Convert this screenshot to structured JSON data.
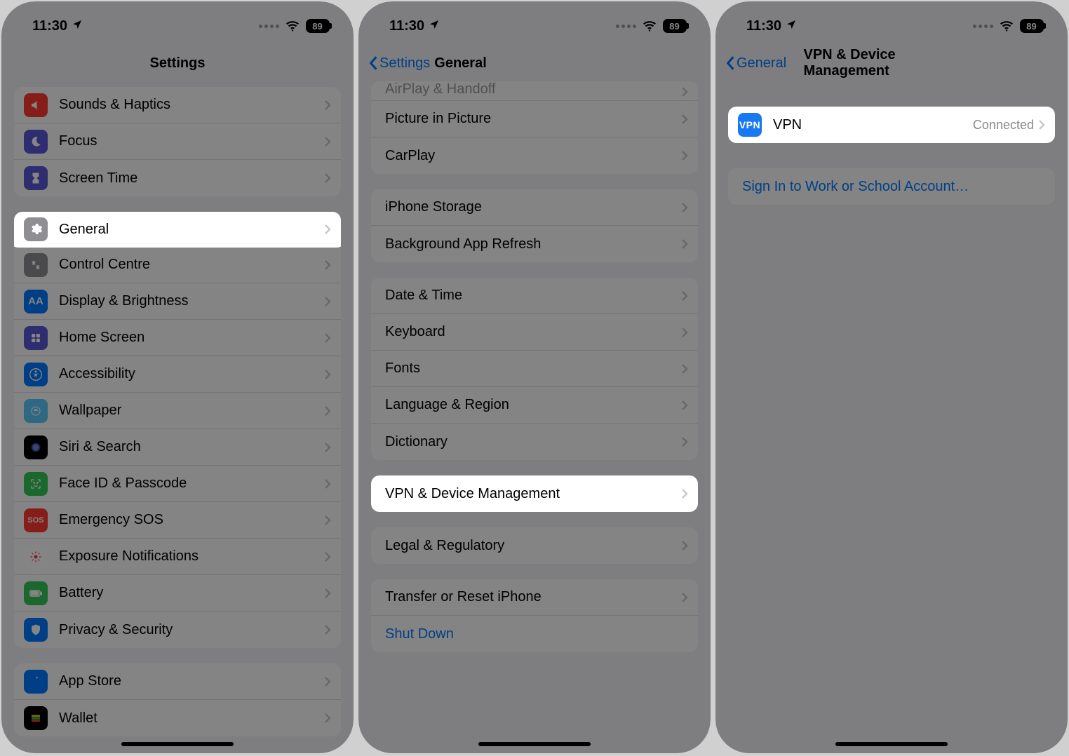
{
  "status": {
    "time": "11:30",
    "battery": "89"
  },
  "p1": {
    "title": "Settings",
    "groups": [
      {
        "rows": [
          {
            "icon": "ic-red",
            "label": "Sounds & Haptics"
          },
          {
            "icon": "ic-purple",
            "label": "Focus"
          },
          {
            "icon": "ic-purple",
            "label": "Screen Time"
          }
        ]
      },
      {
        "rows": [
          {
            "icon": "ic-gear",
            "label": "General"
          },
          {
            "icon": "ic-gray",
            "label": "Control Centre"
          },
          {
            "icon": "ic-blue",
            "label": "Display & Brightness"
          },
          {
            "icon": "ic-purple",
            "label": "Home Screen"
          },
          {
            "icon": "ic-blue",
            "label": "Accessibility"
          },
          {
            "icon": "ic-teal",
            "label": "Wallpaper"
          },
          {
            "icon": "ic-black",
            "label": "Siri & Search"
          },
          {
            "icon": "ic-green",
            "label": "Face ID & Passcode"
          },
          {
            "icon": "ic-sos",
            "label": "Emergency SOS"
          },
          {
            "icon": "ic-white",
            "label": "Exposure Notifications"
          },
          {
            "icon": "ic-green",
            "label": "Battery"
          },
          {
            "icon": "ic-blue",
            "label": "Privacy & Security"
          }
        ]
      },
      {
        "rows": [
          {
            "icon": "ic-blue",
            "label": "App Store"
          },
          {
            "icon": "ic-black",
            "label": "Wallet"
          }
        ]
      }
    ],
    "highlight_index": {
      "group": 1,
      "row": 0
    }
  },
  "p2": {
    "back": "Settings",
    "title": "General",
    "groups": [
      {
        "partial_top": true,
        "rows": [
          {
            "label": "AirPlay & Handoff"
          },
          {
            "label": "Picture in Picture"
          },
          {
            "label": "CarPlay"
          }
        ]
      },
      {
        "rows": [
          {
            "label": "iPhone Storage"
          },
          {
            "label": "Background App Refresh"
          }
        ]
      },
      {
        "rows": [
          {
            "label": "Date & Time"
          },
          {
            "label": "Keyboard"
          },
          {
            "label": "Fonts"
          },
          {
            "label": "Language & Region"
          },
          {
            "label": "Dictionary"
          }
        ]
      },
      {
        "rows": [
          {
            "label": "VPN & Device Management"
          }
        ]
      },
      {
        "rows": [
          {
            "label": "Legal & Regulatory"
          }
        ]
      },
      {
        "rows": [
          {
            "label": "Transfer or Reset iPhone"
          },
          {
            "label": "Shut Down",
            "link": true,
            "no_chevron": true
          }
        ]
      }
    ],
    "highlight_index": {
      "group": 3,
      "row": 0
    }
  },
  "p3": {
    "back": "General",
    "title": "VPN & Device Management",
    "vpn": {
      "label": "VPN",
      "status": "Connected"
    },
    "signin": "Sign In to Work or School Account…"
  }
}
